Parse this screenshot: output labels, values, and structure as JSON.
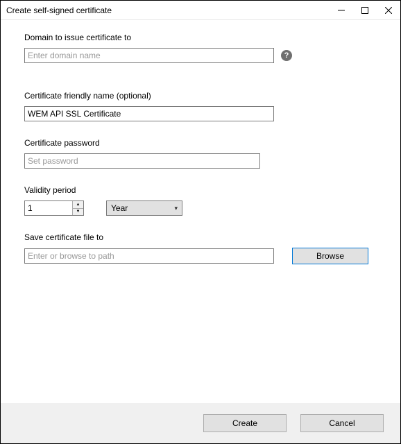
{
  "window": {
    "title": "Create self-signed certificate"
  },
  "domain": {
    "label": "Domain to issue certificate to",
    "placeholder": "Enter domain name",
    "value": "",
    "help": "?"
  },
  "friendly": {
    "label": "Certificate friendly name (optional)",
    "value": "WEM API SSL Certificate"
  },
  "password": {
    "label": "Certificate password",
    "placeholder": "Set password",
    "value": ""
  },
  "validity": {
    "label": "Validity period",
    "number": "1",
    "unit": "Year"
  },
  "save": {
    "label": "Save certificate file to",
    "placeholder": "Enter or browse to path",
    "value": "",
    "browse": "Browse"
  },
  "footer": {
    "create": "Create",
    "cancel": "Cancel"
  }
}
